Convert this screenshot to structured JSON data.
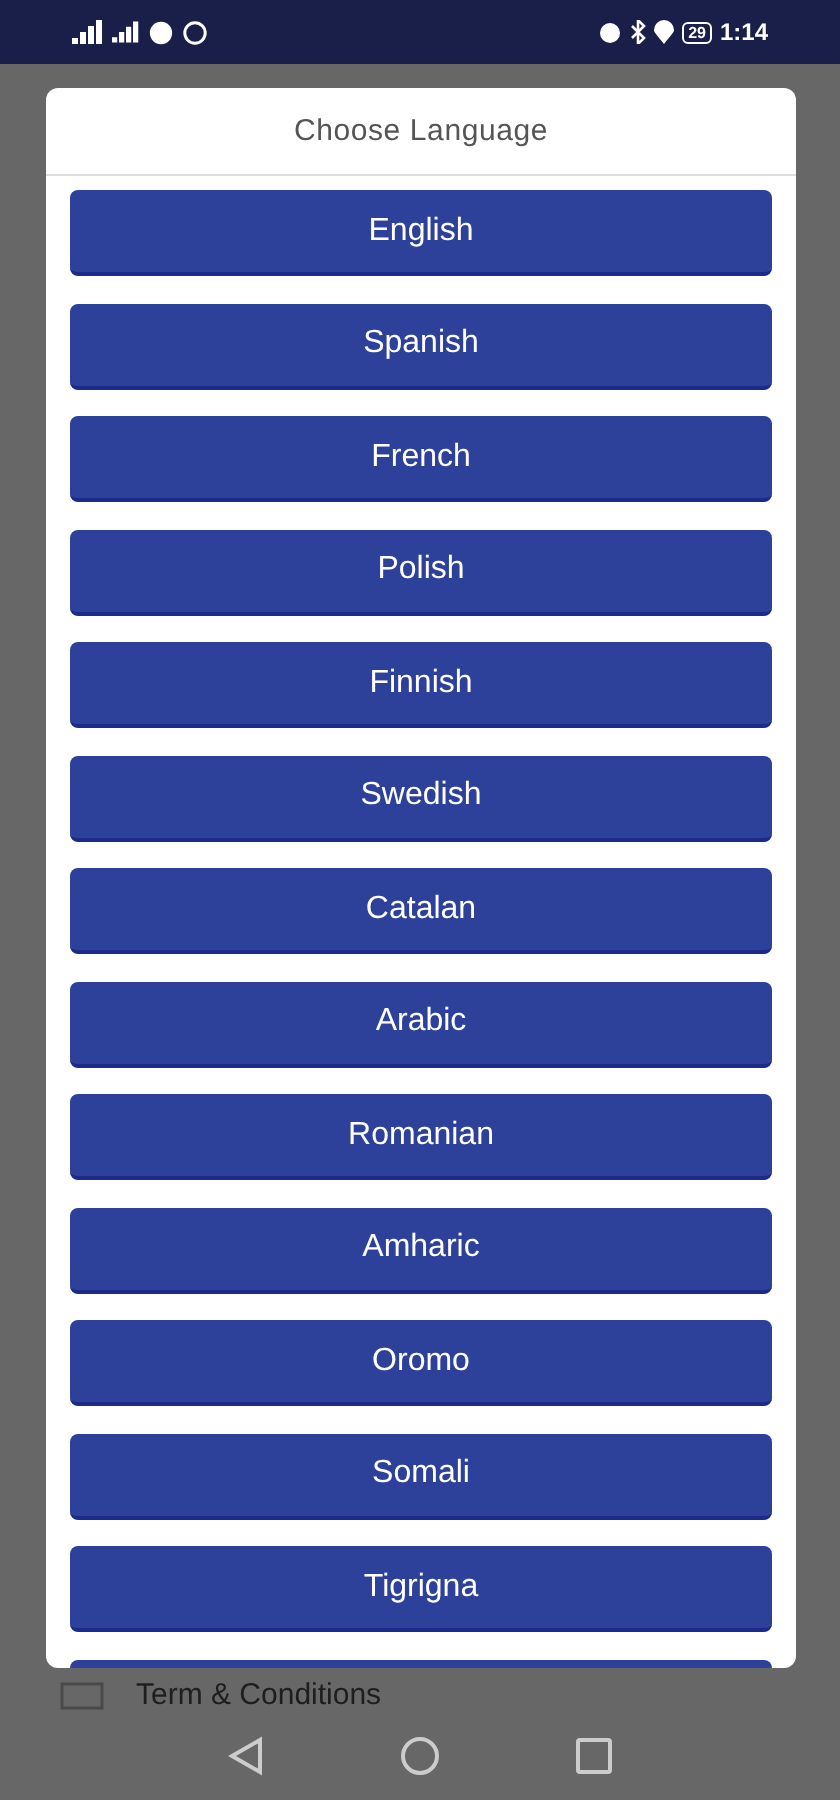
{
  "status_bar": {
    "battery": "29",
    "time": "1:14"
  },
  "background": {
    "link": "Term & Conditions"
  },
  "dialog": {
    "title": "Choose Language",
    "languages": [
      "English",
      "Spanish",
      "French",
      "Polish",
      "Finnish",
      "Swedish",
      "Catalan",
      "Arabic",
      "Romanian",
      "Amharic",
      "Oromo",
      "Somali",
      "Tigrigna"
    ],
    "more_below": true
  }
}
